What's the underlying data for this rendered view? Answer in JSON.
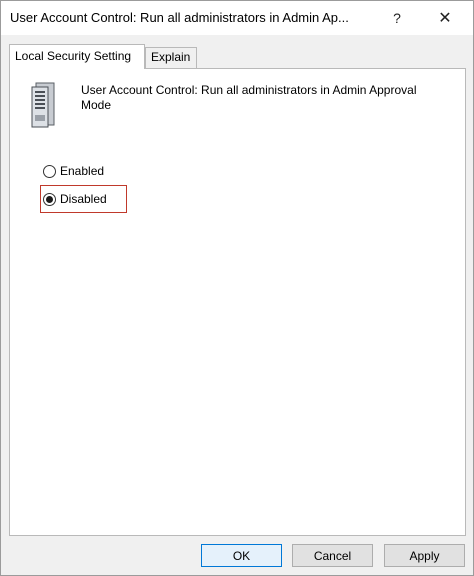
{
  "window": {
    "title": "User Account Control: Run all administrators in Admin Ap...",
    "help_glyph": "?",
    "close_glyph": "✕"
  },
  "tabs": [
    {
      "label": "Local Security Setting",
      "active": true
    },
    {
      "label": "Explain",
      "active": false
    }
  ],
  "policy": {
    "icon": "server-icon",
    "title": "User Account Control: Run all administrators in Admin Approval Mode"
  },
  "options": {
    "selected": "Disabled",
    "items": [
      {
        "label": "Enabled",
        "checked": false
      },
      {
        "label": "Disabled",
        "checked": true
      }
    ],
    "highlight_color": "#c0392b"
  },
  "buttons": {
    "ok": "OK",
    "cancel": "Cancel",
    "apply": "Apply"
  },
  "colors": {
    "accent": "#0078d7"
  }
}
